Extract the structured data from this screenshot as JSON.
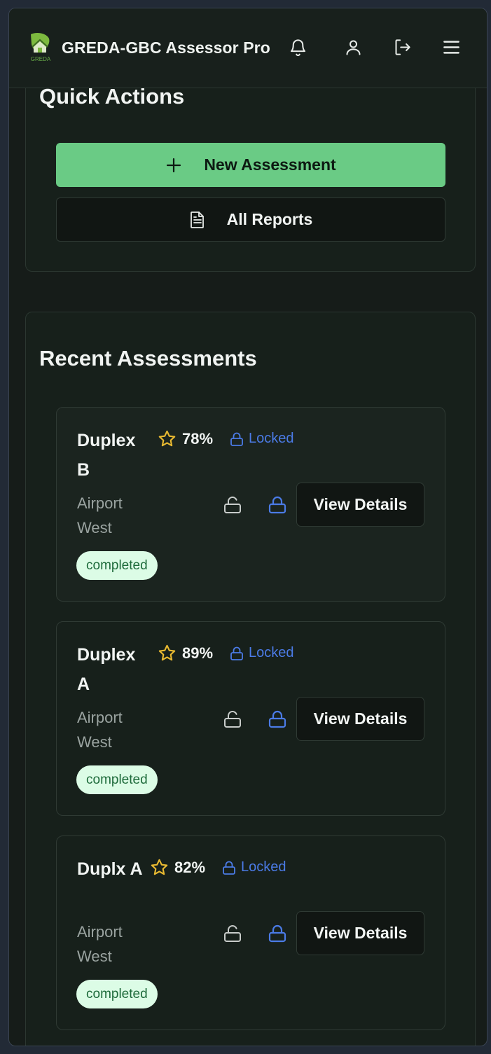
{
  "header": {
    "logo_text": "GREDA",
    "title": "GREDA-GBC Assessor Pro",
    "icons": [
      "bell-icon",
      "user-icon",
      "logout-icon",
      "menu-icon"
    ]
  },
  "quick_actions": {
    "title": "Quick Actions",
    "new_assessment_label": "New Assessment",
    "all_reports_label": "All Reports"
  },
  "recent": {
    "title": "Recent Assessments",
    "items": [
      {
        "name": "Duplex B",
        "score": "78%",
        "lock_label": "Locked",
        "location": "Airport West",
        "status": "completed",
        "view_label": "View Details"
      },
      {
        "name": "Duplex A",
        "score": "89%",
        "lock_label": "Locked",
        "location": "Airport West",
        "status": "completed",
        "view_label": "View Details"
      },
      {
        "name": "Duplx A",
        "score": "82%",
        "lock_label": "Locked",
        "location": "Airport West",
        "status": "completed",
        "view_label": "View Details"
      }
    ]
  },
  "colors": {
    "accent_green": "#6acb85",
    "lock_blue": "#4b7be6",
    "star_gold": "#e8b931",
    "badge_bg": "#dcfce6",
    "badge_text": "#1e6b3b",
    "background": "#161c19"
  }
}
